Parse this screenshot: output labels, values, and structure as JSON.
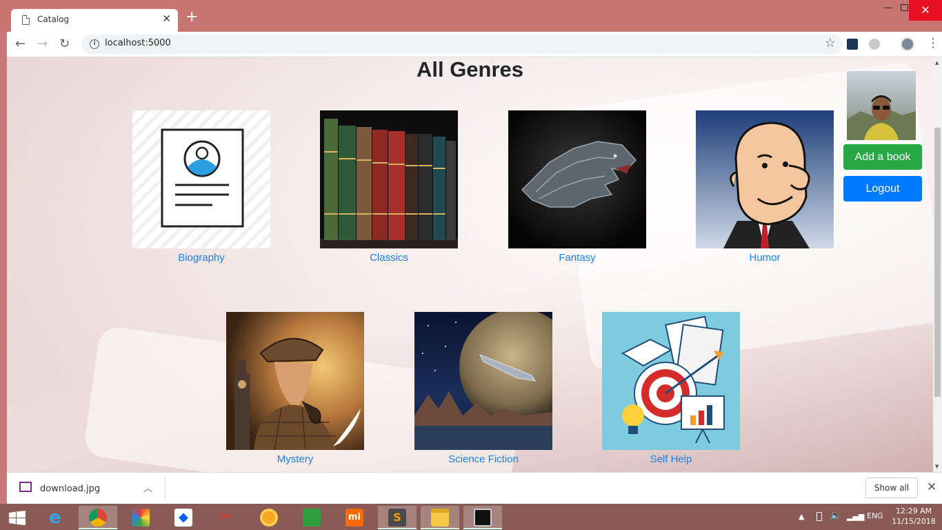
{
  "browser": {
    "tab_title": "Catalog",
    "url": "localhost:5000"
  },
  "page": {
    "title": "All Genres",
    "genres": [
      {
        "label": "Biography"
      },
      {
        "label": "Classics"
      },
      {
        "label": "Fantasy"
      },
      {
        "label": "Humor"
      },
      {
        "label": "Mystery"
      },
      {
        "label": "Science Fiction"
      },
      {
        "label": "Self Help"
      }
    ],
    "add_book_label": "Add a book",
    "logout_label": "Logout"
  },
  "downloads": {
    "file_name": "download.jpg",
    "show_all_label": "Show all"
  },
  "taskbar": {
    "language": "ENG",
    "time": "12:29 AM",
    "date": "11/15/2018"
  },
  "colors": {
    "link": "#1a7ff0",
    "add_button": "#28a745",
    "logout_button": "#007bff"
  }
}
